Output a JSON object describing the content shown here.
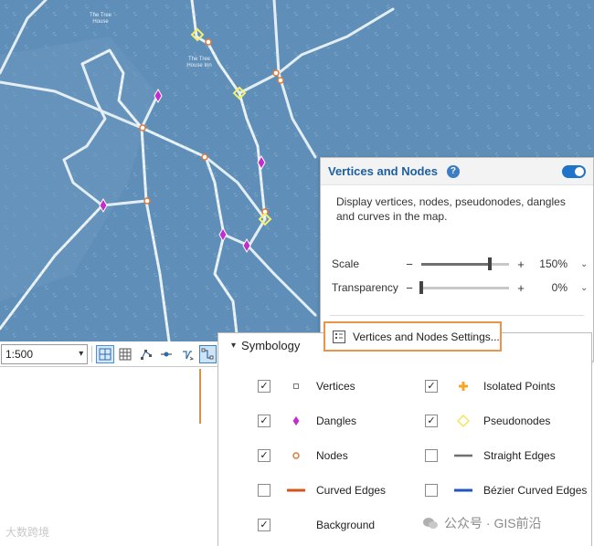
{
  "map": {
    "labels": [
      "The Tree\nHouse",
      "The Tree\nHouse Inn"
    ],
    "colors": {
      "water": "#5f8fb8",
      "line": "#dfe9ee",
      "dangle": "#c42cd0",
      "node": "#e07a38",
      "pseudonode": "#f4f06a"
    }
  },
  "toolbar": {
    "scale_value": "1:500",
    "icons": [
      "snapping-grid-icon",
      "grid-icon",
      "vertex-tool-icon",
      "node-tool-icon",
      "direction-icon",
      "vertices-nodes-icon"
    ]
  },
  "panel": {
    "title": "Vertices and Nodes",
    "help": "?",
    "description": "Display vertices, nodes, pseudonodes, dangles and curves in the map.",
    "scale": {
      "label": "Scale",
      "minus": "−",
      "plus": "+",
      "value": "150%",
      "fraction": 0.78
    },
    "transparency": {
      "label": "Transparency",
      "minus": "−",
      "plus": "+",
      "value": "0%",
      "fraction": 0.0
    },
    "settings_button": "Vertices and Nodes Settings...",
    "toggle_on": true
  },
  "symbology": {
    "header": "Symbology",
    "left": [
      {
        "label": "Vertices",
        "checked": true,
        "glyph": "vertex-square-icon"
      },
      {
        "label": "Dangles",
        "checked": true,
        "glyph": "dangle-diamond-icon"
      },
      {
        "label": "Nodes",
        "checked": true,
        "glyph": "node-circle-icon"
      },
      {
        "label": "Curved Edges",
        "checked": false,
        "glyph": "curved-edge-line-icon"
      },
      {
        "label": "Background",
        "checked": true,
        "glyph": ""
      }
    ],
    "right": [
      {
        "label": "Isolated Points",
        "checked": true,
        "glyph": "isolated-point-plus-icon"
      },
      {
        "label": "Pseudonodes",
        "checked": true,
        "glyph": "pseudonode-diamond-icon"
      },
      {
        "label": "Straight Edges",
        "checked": false,
        "glyph": "straight-edge-line-icon"
      },
      {
        "label": "Bézier Curved Edges",
        "checked": false,
        "glyph": "bezier-edge-line-icon"
      }
    ],
    "check_mark": "✓"
  },
  "watermark": {
    "left": "大数跨境",
    "right": "公众号 · GIS前沿"
  }
}
